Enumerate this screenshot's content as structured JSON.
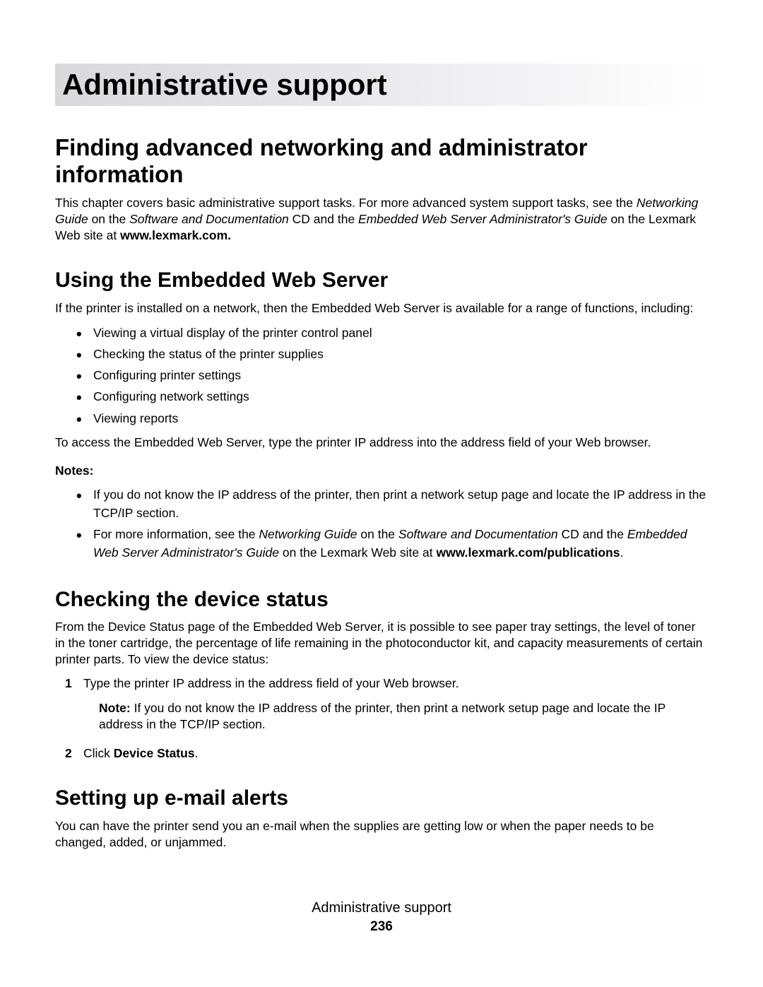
{
  "chapter_title": "Administrative support",
  "section1": {
    "title": "Finding advanced networking and administrator information",
    "para_parts": {
      "t1": "This chapter covers basic administrative support tasks. For more advanced system support tasks, see the ",
      "i1": "Networking Guide",
      "t2": " on the ",
      "i2": "Software and Documentation",
      "t3": " CD and the ",
      "i3": "Embedded Web Server Administrator's Guide",
      "t4": " on the Lexmark Web site at ",
      "b1": "www.lexmark.com.",
      "t5": ""
    }
  },
  "section2": {
    "title": "Using the Embedded Web Server",
    "intro": "If the printer is installed on a network, then the Embedded Web Server is available for a range of functions, including:",
    "bullets": [
      "Viewing a virtual display of the printer control panel",
      "Checking the status of the printer supplies",
      "Configuring printer settings",
      "Configuring network settings",
      "Viewing reports"
    ],
    "access": "To access the Embedded Web Server, type the printer IP address into the address field of your Web browser.",
    "notes_label": "Notes:",
    "note1": "If you do not know the IP address of the printer, then print a network setup page and locate the IP address in the TCP/IP section.",
    "note2_parts": {
      "t1": "For more information, see the ",
      "i1": "Networking Guide",
      "t2": " on the ",
      "i2": "Software and Documentation",
      "t3": " CD and the ",
      "i3": "Embedded Web Server Administrator's Guide",
      "t4": " on the Lexmark Web site at ",
      "b1": "www.lexmark.com/publications",
      "t5": "."
    }
  },
  "section3": {
    "title": "Checking the device status",
    "intro": "From the Device Status page of the Embedded Web Server, it is possible to see paper tray settings, the level of toner in the toner cartridge, the percentage of life remaining in the photoconductor kit, and capacity measurements of certain printer parts. To view the device status:",
    "step1": "Type the printer IP address in the address field of your Web browser.",
    "step1_note_parts": {
      "b1": "Note: ",
      "t1": "If you do not know the IP address of the printer, then print a network setup page and locate the IP address in the TCP/IP section."
    },
    "step2_parts": {
      "t1": "Click ",
      "b1": "Device Status",
      "t2": "."
    }
  },
  "section4": {
    "title": "Setting up e-mail alerts",
    "intro": "You can have the printer send you an e-mail when the supplies are getting low or when the paper needs to be changed, added, or unjammed."
  },
  "footer": {
    "text": "Administrative support",
    "page": "236"
  }
}
